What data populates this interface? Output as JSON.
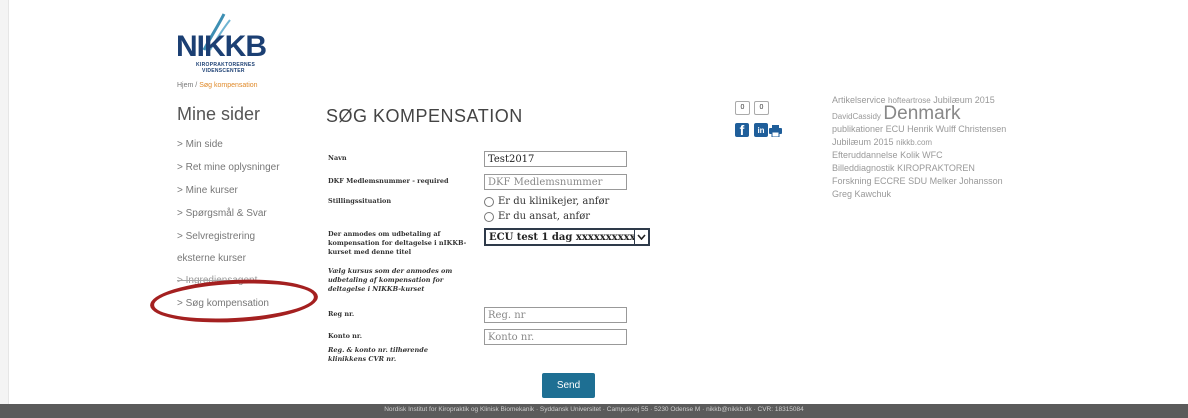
{
  "logo": {
    "name": "NIKKB",
    "sub_line1": "KIROPRAKTORERNES",
    "sub_line2": "VIDENSCENTER"
  },
  "breadcrumb": {
    "home": "Hjem",
    "separator": " / ",
    "current": "Søg kompensation"
  },
  "sidebar": {
    "title": "Mine sider",
    "items": [
      {
        "label": "> Min side"
      },
      {
        "label": "> Ret mine oplysninger"
      },
      {
        "label": "> Mine kurser"
      },
      {
        "label": "> Spørgsmål & Svar"
      },
      {
        "label": "> Selvregistrering"
      },
      {
        "label": "eksterne kurser"
      },
      {
        "label": "> Ingrediensagent"
      },
      {
        "label": "> Søg kompensation"
      }
    ]
  },
  "main": {
    "title": "SØG KOMPENSATION",
    "form": {
      "name_label": "Navn",
      "name_value": "Test2017",
      "member_label": "DKF Medlemsnummer - required",
      "member_placeholder": "DKF Medlemsnummer",
      "position_label": "Stillingssituation",
      "radio_clinic": "Er du klinikejer, anfør",
      "radio_employee": "Er du ansat, anfør",
      "course_label": "Der anmodes om udbetaling af kompensation for deltagelse i nIKKB-kurset med denne titel",
      "course_value": "ECU test 1 dag xxxxxxxxxxxxx",
      "course_help": "Vælg kursus som der anmodes om udbetaling af kompensation for deltagelse i NIKKB-kurset",
      "reg_label": "Reg nr.",
      "reg_placeholder": "Reg. nr",
      "account_label": "Konto nr.",
      "account_placeholder": "Konto nr.",
      "account_help": "Reg. & konto nr. tilhørende klinikkens CVR nr.",
      "send_label": "Send"
    }
  },
  "social": {
    "count_1": "0",
    "count_2": "0",
    "facebook": "f",
    "linkedin": "in",
    "icons": [
      "facebook-icon",
      "linkedin-icon",
      "print-icon"
    ]
  },
  "tags": {
    "t1": "Artikelservice",
    "t2": "hofteartrose",
    "t3": "Jubilæum 2015",
    "t4": "DavidCassidy",
    "t5": "Denmark",
    "t6": "publikationer",
    "t7": "ECU",
    "t8": "Henrik Wulff Christensen",
    "t9": "Jubilæum 2015",
    "t10": "nikkb.com",
    "t11": "Efteruddannelse",
    "t12": "Kolik",
    "t13": "WFC",
    "t14": "Billeddiagnostik",
    "t15": "KIROPRAKTOREN",
    "t16": "Forskning",
    "t17": "ECCRE",
    "t18": "SDU",
    "t19": "Melker Johansson",
    "t20": "Greg Kawchuk"
  },
  "footer": {
    "text": "Nordisk Institut for Kiropraktik og Klinisk Biomekanik · Syddansk Universitet · Campusvej 55 · 5230 Odense M · nikkb@nikkb.dk · CVR: 18315084"
  },
  "colors": {
    "brand": "#1b3f73",
    "send": "#1e6f93",
    "annotation": "#a42020",
    "footer": "#5b5b5b"
  }
}
